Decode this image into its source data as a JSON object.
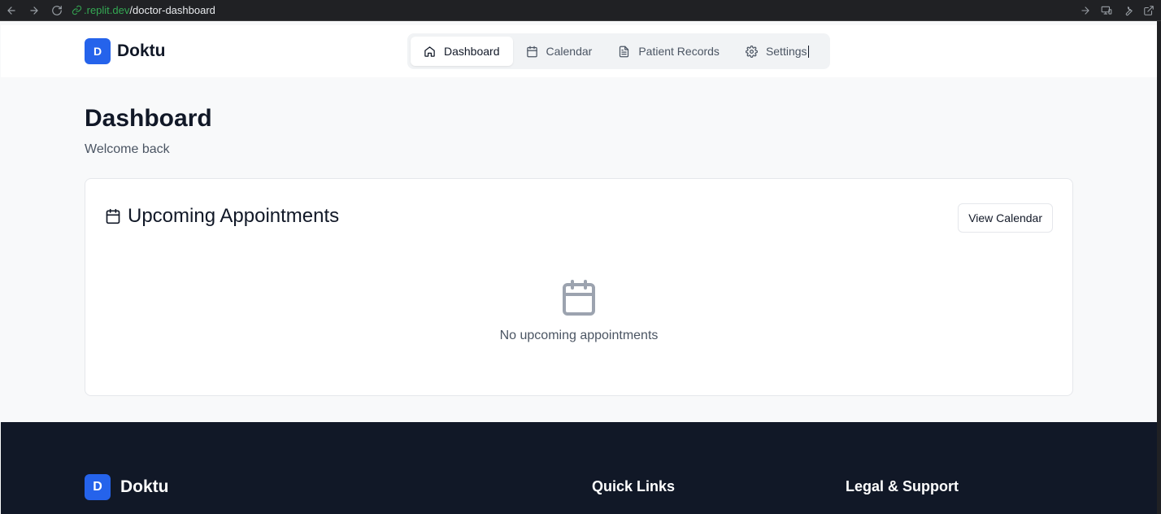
{
  "browser": {
    "url_host": ".replit.dev",
    "url_path": "/doctor-dashboard"
  },
  "header": {
    "logo_letter": "D",
    "brand_name": "Doktu",
    "nav": [
      {
        "label": "Dashboard",
        "icon": "home-icon",
        "active": true
      },
      {
        "label": "Calendar",
        "icon": "calendar-icon",
        "active": false
      },
      {
        "label": "Patient Records",
        "icon": "file-text-icon",
        "active": false
      },
      {
        "label": "Settings",
        "icon": "gear-icon",
        "active": false
      }
    ]
  },
  "main": {
    "title": "Dashboard",
    "subtitle": "Welcome back",
    "appointments_card": {
      "title": "Upcoming Appointments",
      "button_label": "View Calendar",
      "empty_text": "No upcoming appointments"
    }
  },
  "footer": {
    "logo_letter": "D",
    "brand_name": "Doktu",
    "quick_links_title": "Quick Links",
    "legal_title": "Legal & Support"
  },
  "colors": {
    "brand": "#2563eb",
    "footer_bg": "#111827",
    "page_bg": "#f8f9fa",
    "url_host": "#34a853"
  }
}
